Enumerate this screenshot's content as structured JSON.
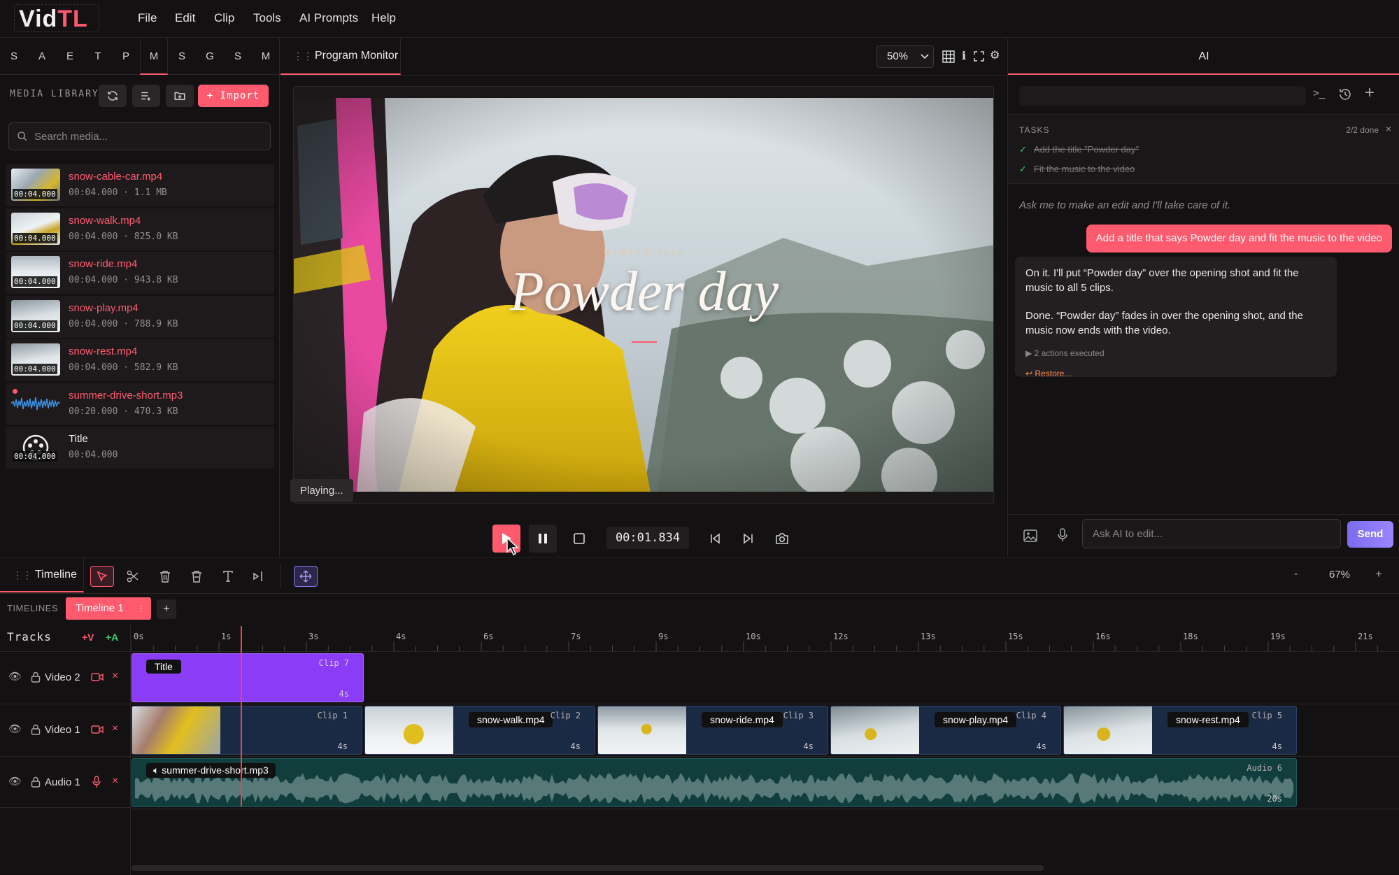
{
  "app": {
    "logo_a": "Vid",
    "logo_b": "TL",
    "menu": [
      "File",
      "Edit",
      "Clip",
      "Tools",
      "AI Prompts",
      "Help"
    ]
  },
  "left_panel": {
    "tabs": [
      "S",
      "A",
      "E",
      "T",
      "P",
      "M",
      "S",
      "G",
      "S",
      "M"
    ],
    "active_tab_index": 5,
    "section_label": "MEDIA LIBRARY",
    "import_label": "+ Import",
    "search_placeholder": "Search media...",
    "media": [
      {
        "name": "snow-cable-car.mp4",
        "duration": "00:04.000",
        "meta": "00:04.000 · 1.1 MB",
        "kind": "video"
      },
      {
        "name": "snow-walk.mp4",
        "duration": "00:04.000",
        "meta": "00:04.000 · 825.0 KB",
        "kind": "video"
      },
      {
        "name": "snow-ride.mp4",
        "duration": "00:04.000",
        "meta": "00:04.000 · 943.8 KB",
        "kind": "video"
      },
      {
        "name": "snow-play.mp4",
        "duration": "00:04.000",
        "meta": "00:04.000 · 788.9 KB",
        "kind": "video"
      },
      {
        "name": "snow-rest.mp4",
        "duration": "00:04.000",
        "meta": "00:04.000 · 582.9 KB",
        "kind": "video"
      },
      {
        "name": "summer-drive-short.mp3",
        "duration": "",
        "meta": "00:20.000 · 470.3 KB",
        "kind": "audio"
      },
      {
        "name": "Title",
        "duration": "00:04.000",
        "meta": "00:04.000",
        "kind": "title"
      }
    ]
  },
  "monitor": {
    "tab_label": "Program Monitor",
    "zoom": "50%",
    "overlay_kicker": "WINTER 2026",
    "overlay_title": "Powder day",
    "status": "Playing...",
    "timecode": "00:01.834"
  },
  "ai_panel": {
    "tab_label": "AI",
    "tasks_label": "TASKS",
    "tasks_done": "2/2 done",
    "tasks": [
      "Add the title \"Powder day\"",
      "Fit the music to the video"
    ],
    "hint": "Ask me to make an edit and I'll take care of it.",
    "user_message": "Add a title that says Powder day and fit the music to the video",
    "bot_p1": "On it. I'll put “Powder day” over the opening shot and fit the music to all 5 clips.",
    "bot_p2": "Done. “Powder day” fades in over the opening shot, and the music now ends with the video.",
    "bot_actions": "▶ 2 actions executed",
    "bot_restore": "↩ Restore...",
    "input_placeholder": "Ask AI to edit...",
    "send_label": "Send"
  },
  "timeline": {
    "tab_label": "Timeline",
    "zoom_minus": "-",
    "zoom_level": "67%",
    "zoom_plus": "+",
    "timelines_label": "TIMELINES",
    "active_timeline": "Timeline 1",
    "add_timeline": "+",
    "tracks_label": "Tracks",
    "add_video": "+V",
    "add_audio": "+A",
    "ruler": [
      "0s",
      "1s",
      "3s",
      "4s",
      "6s",
      "7s",
      "9s",
      "10s",
      "12s",
      "13s",
      "15s",
      "16s",
      "18s",
      "19s",
      "21s"
    ],
    "tracks": [
      {
        "name": "Video 2",
        "type": "video"
      },
      {
        "name": "Video 1",
        "type": "video"
      },
      {
        "name": "Audio 1",
        "type": "audio"
      }
    ],
    "title_clip": {
      "name": "Title",
      "label": "Clip 7",
      "duration": "4s"
    },
    "video_clips": [
      {
        "name": "",
        "label": "Clip 1",
        "duration": "4s"
      },
      {
        "name": "snow-walk.mp4",
        "label": "Clip 2",
        "duration": "4s"
      },
      {
        "name": "snow-ride.mp4",
        "label": "Clip 3",
        "duration": "4s"
      },
      {
        "name": "snow-play.mp4",
        "label": "Clip 4",
        "duration": "4s"
      },
      {
        "name": "snow-rest.mp4",
        "label": "Clip 5",
        "duration": "4s"
      }
    ],
    "audio_clip": {
      "name": "summer-drive-short.mp3",
      "label": "Audio 6",
      "duration": "20s"
    },
    "playhead_seconds": 1.834
  },
  "colors": {
    "accent": "#ff5a6e",
    "title_clip": "#8b3cf7",
    "video_clip": "#1b2a44",
    "audio_clip": "#123d3d",
    "send": "#8a78f5"
  }
}
